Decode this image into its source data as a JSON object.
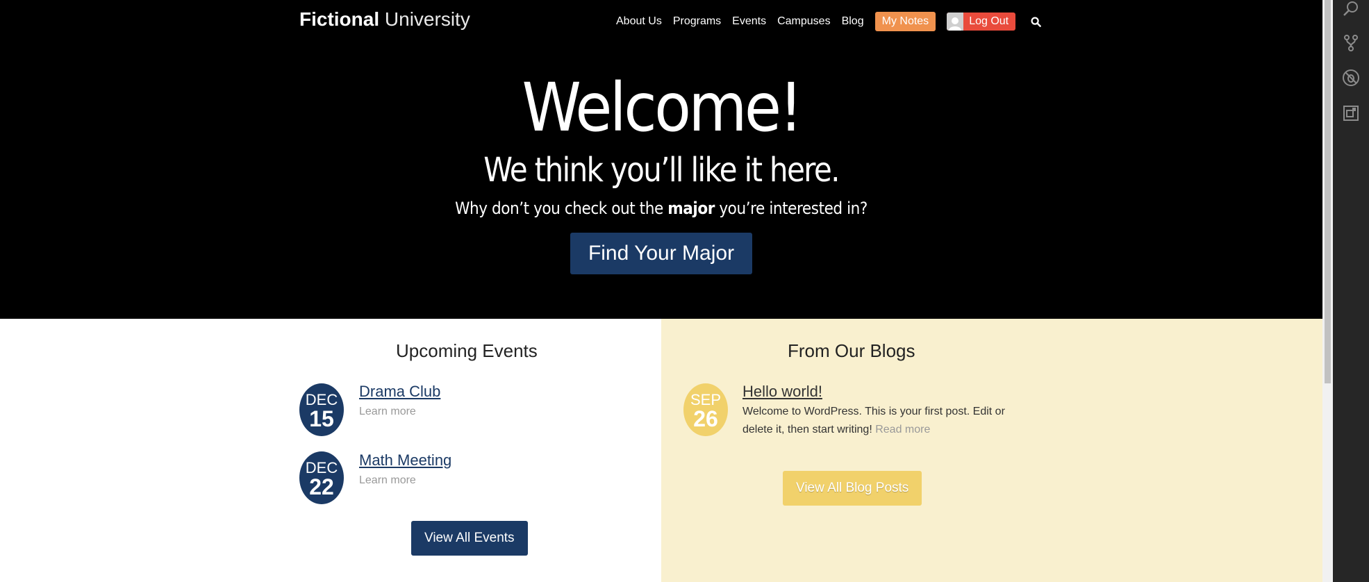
{
  "logo": {
    "bold": "Fictional",
    "light": "University"
  },
  "nav": {
    "items": [
      "About Us",
      "Programs",
      "Events",
      "Campuses",
      "Blog"
    ],
    "notes_label": "My Notes",
    "logout_label": "Log Out",
    "search_icon": "search-icon"
  },
  "hero": {
    "title": "Welcome!",
    "subtitle": "We think you’ll like it here.",
    "cta_prefix": "Why don’t you check out the ",
    "cta_bold": "major",
    "cta_suffix": " you’re interested in?",
    "button": "Find Your Major"
  },
  "events": {
    "title": "Upcoming Events",
    "items": [
      {
        "month": "DEC",
        "day": "15",
        "title": "Drama Club",
        "learn": "Learn more"
      },
      {
        "month": "DEC",
        "day": "22",
        "title": "Math Meeting",
        "learn": "Learn more"
      }
    ],
    "button": "View All Events"
  },
  "blogs": {
    "title": "From Our Blogs",
    "items": [
      {
        "month": "SEP",
        "day": "26",
        "title": "Hello world!",
        "excerpt": "Welcome to WordPress. This is your first post. Edit or delete it, then start writing!",
        "read_more": "Read more"
      }
    ],
    "button": "View All Blog Posts"
  },
  "sidebar_icons": [
    "search-icon",
    "source-control-icon",
    "debug-icon",
    "extensions-icon"
  ],
  "colors": {
    "navy": "#1b3a65",
    "gold": "#f1d16b",
    "blog_bg": "#f9f0cf",
    "notes_orange": "#f0924e",
    "logout_red": "#e94b3c"
  }
}
